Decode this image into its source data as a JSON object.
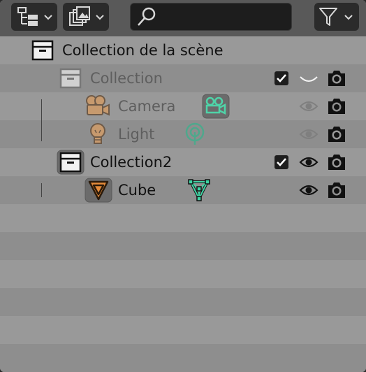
{
  "header": {
    "display_mode_icon": "outliner-tree-icon",
    "filter_icon": "funnel-filter-icon",
    "search": {
      "value": "",
      "placeholder": ""
    }
  },
  "tree": {
    "root": {
      "label": "Collection de la scène",
      "icon": "scene-collection-icon"
    },
    "items": [
      {
        "label": "Collection",
        "icon": "collection-icon",
        "dim": true,
        "expanded": true,
        "checkbox": true,
        "visibility": "hidden",
        "render": true
      },
      {
        "label": "Camera",
        "icon": "camera-object-icon",
        "data_icon": "camera-data-icon",
        "dim": true,
        "expanded": false,
        "visibility": "eye-dim",
        "render": true
      },
      {
        "label": "Light",
        "icon": "light-object-icon",
        "data_icon": "light-data-icon",
        "dim": true,
        "expanded": false,
        "visibility": "eye-dim",
        "render": true
      },
      {
        "label": "Collection2",
        "icon": "collection-icon",
        "dim": false,
        "expanded": true,
        "checkbox": true,
        "visibility": "eye",
        "render": true
      },
      {
        "label": "Cube",
        "icon": "mesh-object-icon",
        "data_icon": "mesh-data-icon",
        "dim": false,
        "expanded": false,
        "visibility": "eye",
        "render": true
      }
    ]
  },
  "colors": {
    "header_bg": "#595959",
    "row_light": "#999999",
    "row_dark": "#8e8e8e",
    "mesh_orange": "#e58b3a",
    "data_green": "#3fd4a4",
    "object_tan": "#c79a6e"
  }
}
